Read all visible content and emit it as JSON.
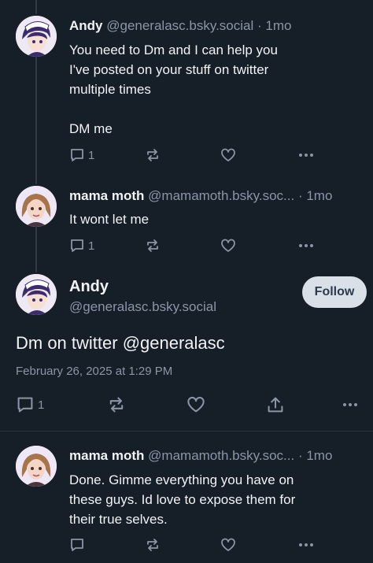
{
  "posts": [
    {
      "author": "Andy",
      "handle": "@generalasc.bsky.social",
      "age": "1mo",
      "lines": [
        "You need to Dm and I can help you",
        "I've posted on your stuff on twitter",
        "multiple times",
        "",
        "DM me"
      ],
      "reply_count": "1",
      "avatar_icon": "anime-avatar-icon"
    },
    {
      "author": "mama moth",
      "handle": "@mamamoth.bsky.soc...",
      "age": "1mo",
      "lines": [
        "It wont let me"
      ],
      "reply_count": "1",
      "avatar_icon": "moth-avatar-icon"
    }
  ],
  "focus_post": {
    "author": "Andy",
    "handle": "@generalasc.bsky.social",
    "follow_label": "Follow",
    "text": "Dm on twitter @generalasc",
    "timestamp": "February 26, 2025 at 1:29 PM",
    "reply_count": "1"
  },
  "reply_post": {
    "author": "mama moth",
    "handle": "@mamamoth.bsky.soc...",
    "age": "1mo",
    "lines": [
      "Done. Gimme everything you have on",
      "these guys. Id love to expose them for",
      "their true selves."
    ]
  },
  "separator": "·",
  "colors": {
    "background": "#161e27",
    "muted": "#8a96a6",
    "follow_bg": "#d9e0e8"
  }
}
